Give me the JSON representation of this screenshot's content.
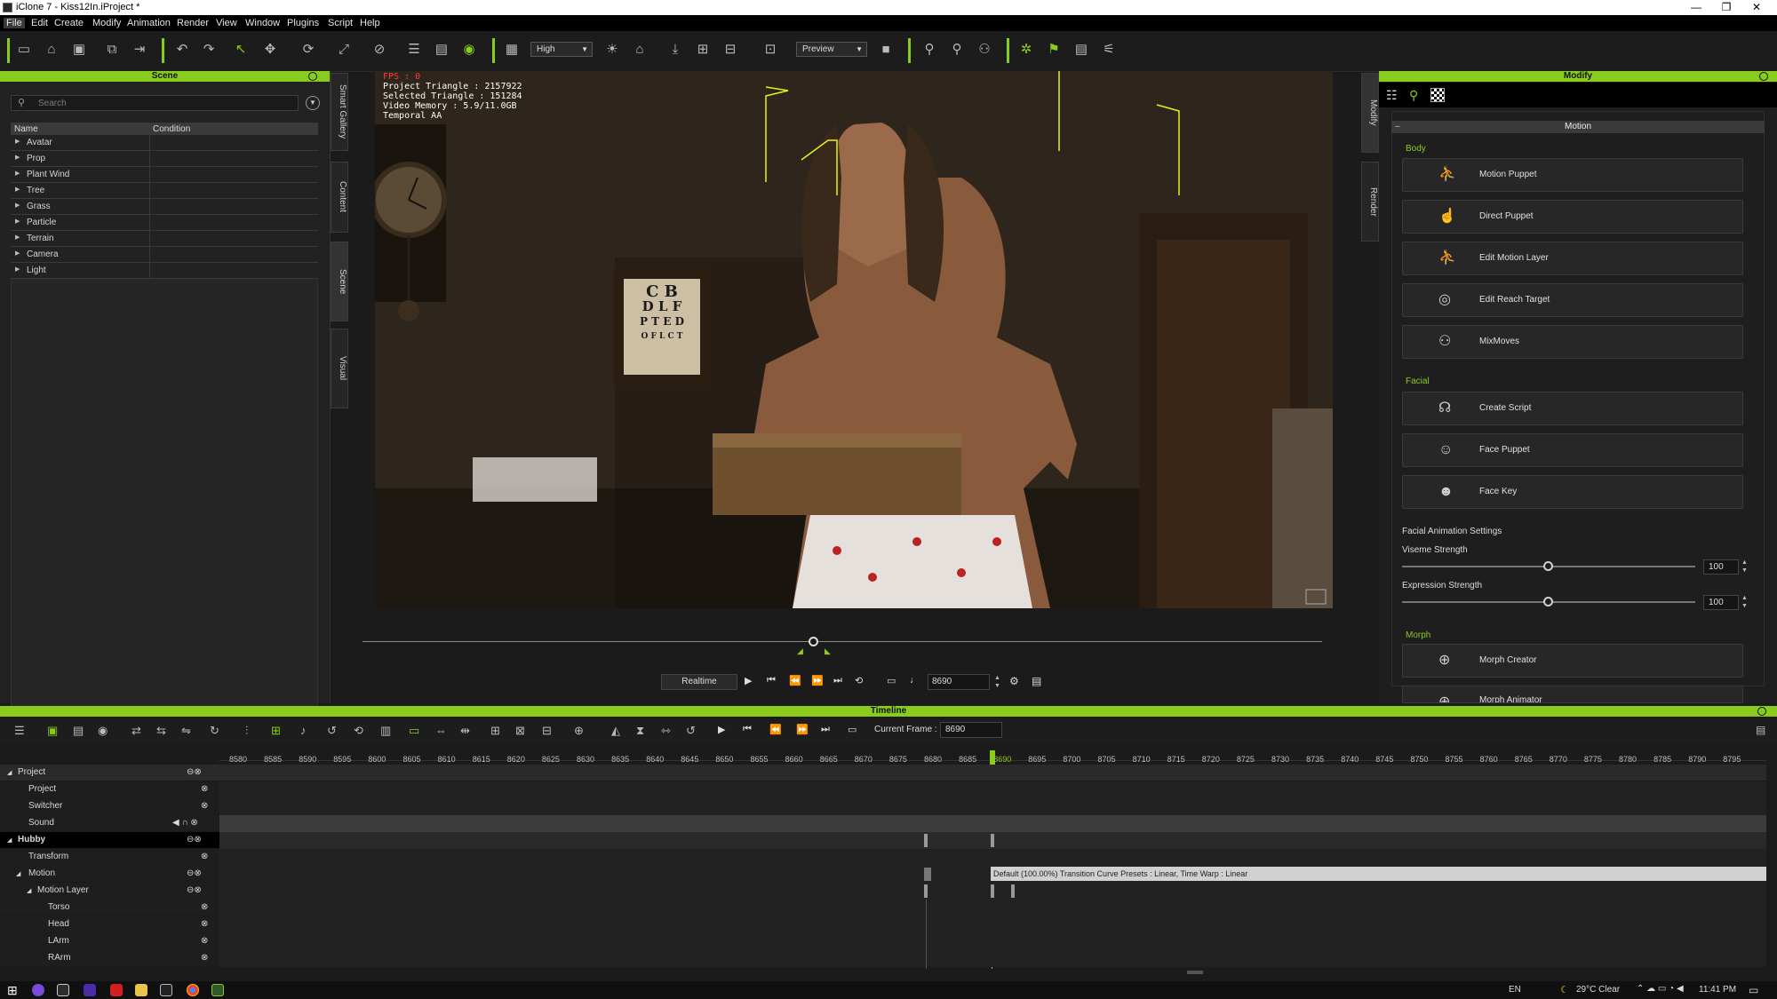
{
  "window": {
    "title": "iClone 7 - Kiss12In.iProject *",
    "controls": [
      "—",
      "❐",
      "✕"
    ]
  },
  "menu": [
    "File",
    "Edit",
    "Create",
    "Modify",
    "Animation",
    "Render",
    "View",
    "Window",
    "Plugins",
    "Script",
    "Help"
  ],
  "toolbar": {
    "quality": "High",
    "render_mode": "Preview"
  },
  "scene": {
    "title": "Scene",
    "search_placeholder": "Search",
    "columns": [
      "Name",
      "Condition"
    ],
    "items": [
      "Avatar",
      "Prop",
      "Plant Wind",
      "Tree",
      "Grass",
      "Particle",
      "Terrain",
      "Camera",
      "Light"
    ]
  },
  "left_tabs": [
    "Smart Gallery",
    "Content",
    "Scene",
    "Visual"
  ],
  "right_tabs": [
    "Modify",
    "Render"
  ],
  "viewport": {
    "hud": [
      "FPS : 0",
      "Project Triangle : 2157922",
      "Selected Triangle : 151284",
      "Video Memory : 5.9/11.0GB",
      "Temporal AA"
    ],
    "chart_text": [
      "C B",
      "D L F",
      "P T E D",
      "O F L C T"
    ]
  },
  "playback": {
    "realtime_label": "Realtime",
    "frame": "8690"
  },
  "modify": {
    "title": "Modify",
    "section": "Motion",
    "body_label": "Body",
    "body_buttons": [
      "Motion Puppet",
      "Direct Puppet",
      "Edit Motion Layer",
      "Edit Reach Target",
      "MixMoves"
    ],
    "facial_label": "Facial",
    "facial_buttons": [
      "Create Script",
      "Face Puppet",
      "Face Key"
    ],
    "facial_settings_label": "Facial Animation Settings",
    "viseme_label": "Viseme Strength",
    "viseme_value": "100",
    "expression_label": "Expression Strength",
    "expression_value": "100",
    "morph_label": "Morph",
    "morph_buttons": [
      "Morph Creator",
      "Morph Animator"
    ]
  },
  "timeline": {
    "title": "Timeline",
    "current_frame_label": "Current Frame :",
    "current_frame": "8690",
    "ticks": [
      "8580",
      "8585",
      "8590",
      "8595",
      "8600",
      "8605",
      "8610",
      "8615",
      "8620",
      "8625",
      "8630",
      "8635",
      "8640",
      "8645",
      "8650",
      "8655",
      "8660",
      "8665",
      "8670",
      "8675",
      "8680",
      "8685",
      "8690",
      "8695",
      "8700",
      "8705",
      "8710",
      "8715",
      "8720",
      "8725",
      "8730",
      "8735",
      "8740",
      "8745",
      "8750",
      "8755",
      "8760",
      "8765",
      "8770",
      "8775",
      "8780",
      "8785",
      "8790",
      "8795"
    ],
    "tracks": [
      "Project",
      "Project",
      "Switcher",
      "Sound",
      "Hubby",
      "Transform",
      "Motion",
      "Motion Layer",
      "Torso",
      "Head",
      "LArm",
      "RArm"
    ],
    "clip_label": "Default (100.00%) Transition Curve Presets : Linear, Time Warp : Linear"
  },
  "taskbar": {
    "lang": "EN",
    "weather": "29°C  Clear",
    "time": "11:41 PM"
  },
  "colors": {
    "accent": "#8acc1e",
    "panel": "#222222",
    "hud_warning": "#ff3c3c"
  }
}
